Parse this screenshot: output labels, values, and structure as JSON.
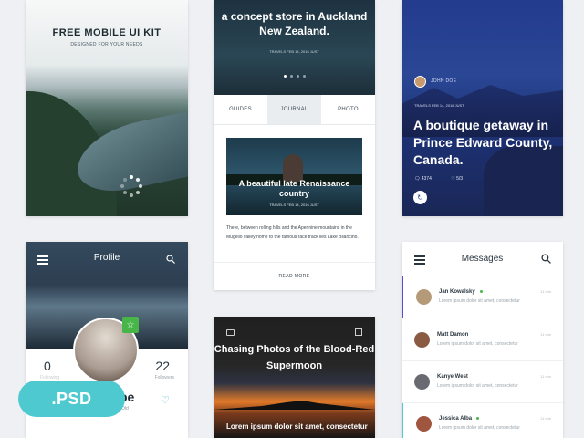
{
  "splash": {
    "title": "FREE MOBILE UI KIT",
    "subtitle": "DESIGNED FOR YOUR NEEDS"
  },
  "journal": {
    "hero_title": "a concept store in Auckland New Zealand.",
    "hero_meta": "TRAVELS  FEB 14, 2016  JUST",
    "tabs": [
      "GUIDES",
      "JOURNAL",
      "PHOTO"
    ],
    "active_tab": "JOURNAL",
    "article_title": "A beautiful late Renaissance country",
    "article_meta": "TRAVELS  FEB 14, 2016  JUST",
    "body": "There, between rolling hills and the Apennine mountains in the Mugello valley home to the famous race track lies Lake Bilancino.",
    "read_more": "READ MORE"
  },
  "feature": {
    "author": "JOHN DOE",
    "meta": "TRAVELS  FEB 14, 2016  JUST",
    "title": "A boutique getaway in Prince Edward County, Canada.",
    "comments": "4374",
    "likes": "5/3"
  },
  "profile": {
    "title": "Profile",
    "following_count": "0",
    "following_label": "Following",
    "followers_count": "22",
    "followers_label": "Followers",
    "name_fragment": "be",
    "location_fragment": "Old"
  },
  "badge": {
    "label": ".PSD"
  },
  "moon": {
    "title": "Chasing Photos of the Blood-Red Supermoon",
    "lorem": "Lorem ipsum dolor sit amet, consectetur"
  },
  "messages": {
    "title": "Messages",
    "items": [
      {
        "name": "Jan Kowalsky",
        "online": true,
        "preview": "Lorem ipsum dolor sit amet, consectetur",
        "time": "11 min",
        "avatar_color": "#b59a7a"
      },
      {
        "name": "Matt Damon",
        "online": false,
        "preview": "Lorem ipsum dolor sit amet, consectetur",
        "time": "11 min",
        "avatar_color": "#8a5a42"
      },
      {
        "name": "Kanye West",
        "online": false,
        "preview": "Lorem ipsum dolor sit amet, consectetur",
        "time": "11 min",
        "avatar_color": "#6a6a72"
      },
      {
        "name": "Jessica Alba",
        "online": true,
        "preview": "Lorem ipsum dolor sit amet, consectetur",
        "time": "11 min",
        "avatar_color": "#a0563e"
      }
    ]
  },
  "colors": {
    "accent_teal": "#4ec9cf",
    "accent_purple": "#5a4fcf",
    "online_green": "#47b548"
  }
}
